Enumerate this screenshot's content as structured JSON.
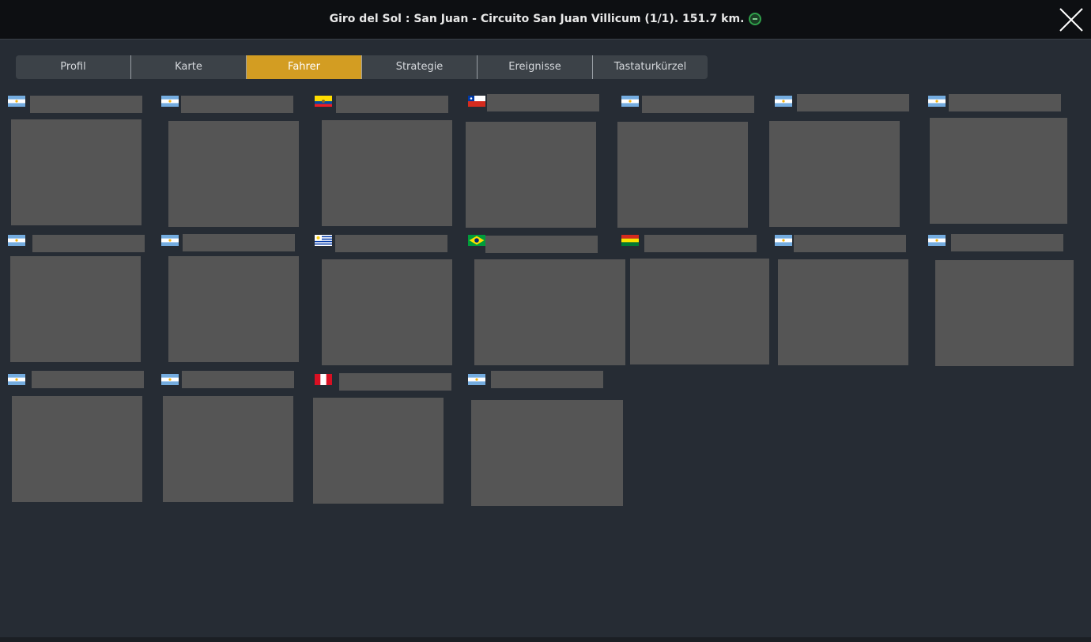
{
  "header": {
    "title": "Giro del Sol : San Juan - Circuito San Juan Villicum (1/1). 151.7 km.",
    "stage_icon": "flat-stage-icon",
    "close_icon": "close-icon"
  },
  "tabs": [
    {
      "label": "Profil",
      "active": false
    },
    {
      "label": "Karte",
      "active": false
    },
    {
      "label": "Fahrer",
      "active": true
    },
    {
      "label": "Strategie",
      "active": false
    },
    {
      "label": "Ereignisse",
      "active": false
    },
    {
      "label": "Tastaturkürzel",
      "active": false
    }
  ],
  "colors": {
    "background": "#262c34",
    "titlebar": "#0d0f12",
    "tab": "#3c4248",
    "tab_active": "#d39d22",
    "placeholder": "#555555"
  },
  "riders": [
    {
      "country": "argentina"
    },
    {
      "country": "argentina"
    },
    {
      "country": "ecuador"
    },
    {
      "country": "chile"
    },
    {
      "country": "argentina"
    },
    {
      "country": "argentina"
    },
    {
      "country": "argentina"
    },
    {
      "country": "argentina"
    },
    {
      "country": "argentina"
    },
    {
      "country": "uruguay"
    },
    {
      "country": "brazil"
    },
    {
      "country": "bolivia"
    },
    {
      "country": "argentina"
    },
    {
      "country": "argentina"
    },
    {
      "country": "argentina"
    },
    {
      "country": "argentina"
    },
    {
      "country": "peru"
    },
    {
      "country": "argentina"
    }
  ]
}
